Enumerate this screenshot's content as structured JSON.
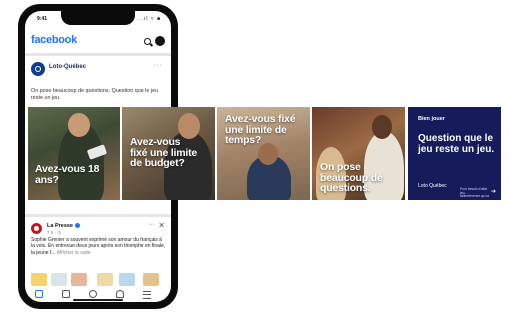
{
  "status_bar": {
    "time": "9:41",
    "indicators": "..ıl ≈ ■"
  },
  "facebook": {
    "logo": "facebook",
    "search_icon": "search-icon",
    "messenger_icon": "messenger-icon"
  },
  "post": {
    "page_name": "Loto-Québec",
    "more": "···",
    "text": "On pose beaucoup de questions. Question que le jeu reste un jeu."
  },
  "carousel": [
    {
      "caption": "Avez-vous 18 ans?"
    },
    {
      "caption": "Avez-vous fixé une limite de budget?"
    },
    {
      "caption": "Avez-vous fixé une limite de temps?"
    },
    {
      "caption": "On pose beaucoup de questions."
    },
    {
      "logo_top": "Bien jouer",
      "caption": "Question que le jeu reste un jeu.",
      "logo_bottom": "Loto Québec",
      "fineprint": "Pour besoin d'aide jeu-aidereference.qc.ca"
    }
  ],
  "news_post": {
    "page_name": "La Presse",
    "meta": "7 h · ◷",
    "text": "Sophie Grenier a souvent exprimé son amour du français à la voix. En entrevue deux jours après son triomphe en finale, la jeune f...",
    "more": "Afficher la suite"
  },
  "tabbar": [
    "home-icon",
    "video-icon",
    "groups-icon",
    "notifications-icon",
    "menu-icon"
  ],
  "colors": {
    "facebook_blue": "#1877f2",
    "loto_navy": "#161b5c"
  }
}
